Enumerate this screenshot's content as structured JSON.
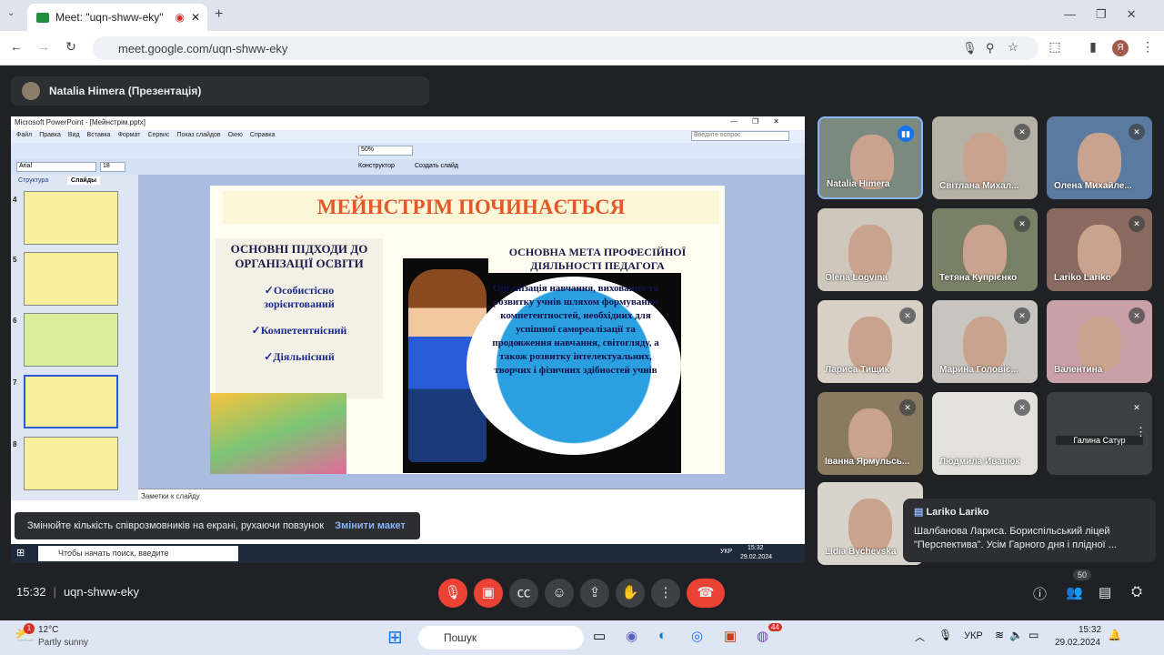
{
  "browser": {
    "tab_title": "Meet: \"uqn-shww-eky\"",
    "url": "meet.google.com/uqn-shww-eky",
    "profile_letter": "Я"
  },
  "presenter": {
    "label": "Natalia Himera (Презентація)"
  },
  "powerpoint": {
    "title": "Microsoft PowerPoint - [Мейнстрім.pptx]",
    "menu": [
      "Файл",
      "Правка",
      "Вид",
      "Вставка",
      "Формат",
      "Сервис",
      "Показ слайдов",
      "Окно",
      "Справка"
    ],
    "help_placeholder": "Введите вопрос",
    "zoom": "50%",
    "font": "Arial",
    "font_size": "18",
    "designer": "Конструктор",
    "new_slide": "Создать слайд",
    "panel_tabs": [
      "Структура",
      "Слайды"
    ],
    "thumb_numbers": [
      "4",
      "5",
      "6",
      "7",
      "8"
    ],
    "notes": "Заметки к слайду"
  },
  "slide": {
    "title": "МЕЙНСТРІМ ПОЧИНАЄТЬСЯ",
    "left_heading": "ОСНОВНІ ПІДХОДИ ДО ОРГАНІЗАЦІЇ ОСВІТИ",
    "approaches": [
      "✓Особистісно зорієнтований",
      "✓Компетентнісний",
      "✓Діяльнісний"
    ],
    "right_heading": "ОСНОВНА МЕТА ПРОФЕСІЙНОЇ ДІЯЛЬНОСТІ ПЕДАГОГА",
    "goal_text": "Організація навчання, виховання та розвитку учнів шляхом формування компетентностей, необхідних для успішної самореалізації та продовження навчання, світогляду, а також розвитку інтелектуальних, творчих і фізичних здібностей учнів"
  },
  "inner_taskbar": {
    "search": "Чтобы начать поиск, введите",
    "lang": "УКР",
    "time": "15:32",
    "date": "29.02.2024"
  },
  "toast": {
    "text": "Змінюйте кількість співрозмовників на екрані, рухаючи повзунок",
    "action": "Змінити макет"
  },
  "participants": [
    "Natalia Himera",
    "Світлана Михал...",
    "Олена Михайле...",
    "Olena Logvina",
    "Тетяна Купрієнко",
    "Lariko Lariko",
    "Лариса Тищик",
    "Марина Головіє...",
    "Валентина",
    "Іванна Ярмульсь...",
    "Людмила Иванюк",
    "Галина Сатур",
    "Lidia Bychevska"
  ],
  "chat": {
    "sender": "Lariko Lariko",
    "message": "Шалбанова Лариса. Бориспільський ліцей \"Перспектива\". Усім Гарного дня і плідної ..."
  },
  "meeting": {
    "time": "15:32",
    "code": "uqn-shww-eky",
    "people_count": "50"
  },
  "weather": {
    "temp": "12°C",
    "desc": "Partly sunny",
    "badge": "1"
  },
  "taskbar": {
    "search": "Пошук",
    "lang": "УКР",
    "time": "15:32",
    "date": "29.02.2024",
    "badge": "44"
  }
}
